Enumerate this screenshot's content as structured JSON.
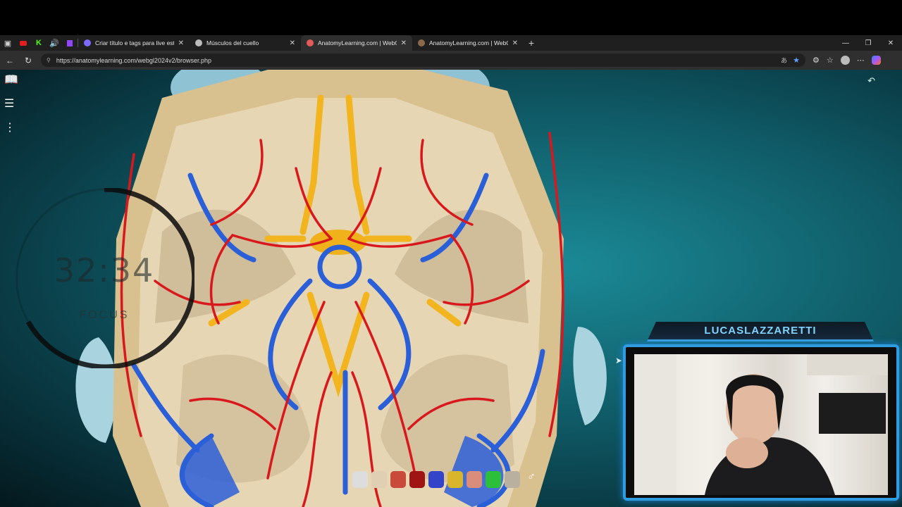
{
  "browser": {
    "tabs": [
      {
        "title": "Criar título e tags para live estudo",
        "favicon_color": "#7c6cff",
        "active": false
      },
      {
        "title": "Músculos del cuello",
        "favicon_color": "#bbbbbb",
        "active": false
      },
      {
        "title": "AnatomyLearning.com | WebGL P",
        "favicon_color": "#e25b5b",
        "active": true
      },
      {
        "title": "AnatomyLearning.com | WebGL P",
        "favicon_color": "#8a6a4a",
        "active": false
      }
    ],
    "new_tab_label": "+",
    "url": "https://anatomylearning.com/webgl2024v2/browser.php"
  },
  "app": {
    "timer": {
      "time": "32:34",
      "label": "FOCUS"
    }
  },
  "stream": {
    "streamer_name": "LUCASLAZZARETTI"
  },
  "colors": {
    "accent_blue": "#2f9be0",
    "background_teal": "#1b8a96",
    "bone": "#e3cfa4",
    "artery": "#d8181c",
    "vein": "#2b5fd8",
    "nerve": "#f2b51f"
  },
  "icons": {
    "side_tools": [
      "book-icon",
      "comment-list-icon",
      "more-vertical-icon"
    ],
    "bottom_tools": [
      "skeleton-icon",
      "skull-icon",
      "muscle-icon",
      "heart-icon",
      "vascular-icon",
      "nerve-icon",
      "organ-icon",
      "lymph-icon",
      "joint-icon",
      "gender-icon"
    ]
  }
}
